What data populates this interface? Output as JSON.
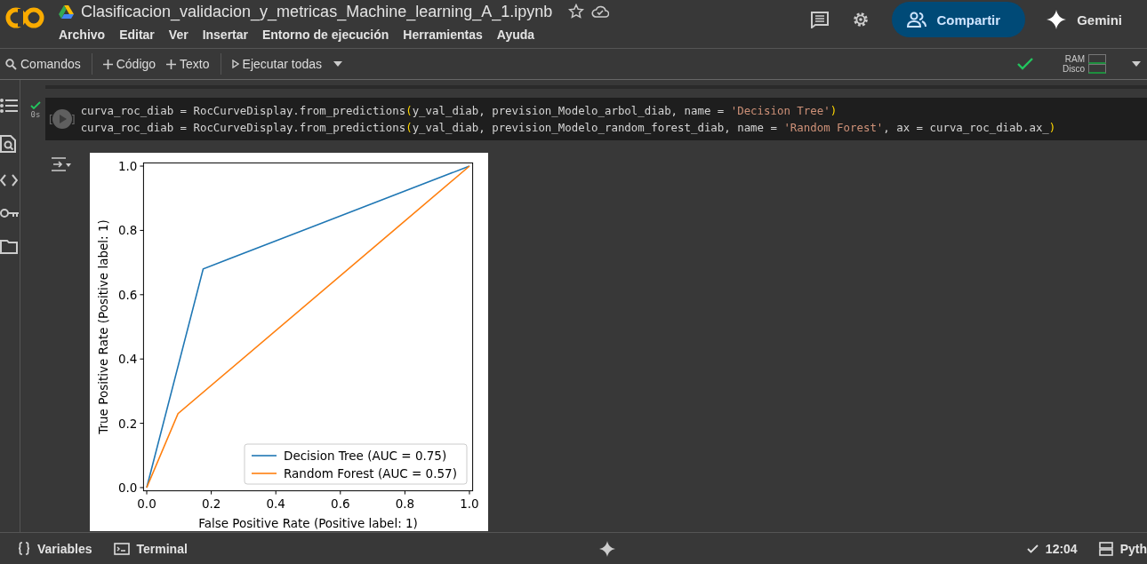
{
  "header": {
    "title": "Clasificacion_validacion_y_metricas_Machine_learning_A_1.ipynb",
    "menu": [
      "Archivo",
      "Editar",
      "Ver",
      "Insertar",
      "Entorno de ejecución",
      "Herramientas",
      "Ayuda"
    ],
    "share_button": "Compartir",
    "gemini_button": "Gemini"
  },
  "toolbar": {
    "commands": "Comandos",
    "add_code": "Código",
    "add_text": "Texto",
    "run_all": "Ejecutar todas",
    "resources": [
      "RAM",
      "Disco"
    ]
  },
  "cell": {
    "run_time": "0s",
    "bracket_open": "[",
    "bracket_close": "]",
    "lines": [
      [
        {
          "kind": "plain",
          "text": "curva_roc_diab = RocCurveDisplay.from_predictions"
        },
        {
          "kind": "paren",
          "text": "("
        },
        {
          "kind": "plain",
          "text": "y_val_diab, prevision_Modelo_arbol_diab, name = "
        },
        {
          "kind": "string",
          "text": "'Decision Tree'"
        },
        {
          "kind": "paren",
          "text": ")"
        }
      ],
      [
        {
          "kind": "plain",
          "text": "curva_roc_diab = RocCurveDisplay.from_predictions"
        },
        {
          "kind": "paren",
          "text": "("
        },
        {
          "kind": "plain",
          "text": "y_val_diab, prevision_Modelo_random_forest_diab, name = "
        },
        {
          "kind": "string",
          "text": "'Random Forest'"
        },
        {
          "kind": "plain",
          "text": ", ax = curva_roc_diab.ax_"
        },
        {
          "kind": "paren",
          "text": ")"
        }
      ]
    ],
    "output": {
      "chart_data": {
        "type": "line",
        "legend": true,
        "xlabel": "False Positive Rate (Positive label: 1)",
        "ylabel": "True Positive Rate (Positive label: 1)",
        "xlim": [
          -0.01,
          1.01
        ],
        "ylim": [
          -0.01,
          1.01
        ],
        "xticks": [
          {
            "value": 0,
            "label": "0.0"
          },
          {
            "value": 0.2,
            "label": "0.2"
          },
          {
            "value": 0.4,
            "label": "0.4"
          },
          {
            "value": 0.6,
            "label": "0.6"
          },
          {
            "value": 0.8,
            "label": "0.8"
          },
          {
            "value": 1,
            "label": "1.0"
          }
        ],
        "yticks": [
          {
            "value": 0,
            "label": "0.0"
          },
          {
            "value": 0.2,
            "label": "0.2"
          },
          {
            "value": 0.4,
            "label": "0.4"
          },
          {
            "value": 0.6,
            "label": "0.6"
          },
          {
            "value": 0.8,
            "label": "0.8"
          },
          {
            "value": 1,
            "label": "1.0"
          }
        ],
        "series": [
          {
            "name": "Decision Tree (AUC = 0.75)",
            "color": "#1f77b4",
            "x": [
              0,
              0.175,
              1
            ],
            "values": [
              0,
              0.68,
              1
            ]
          },
          {
            "name": "Random Forest (AUC = 0.57)",
            "color": "#ff7f0e",
            "x": [
              0,
              0.097,
              1
            ],
            "values": [
              0,
              0.23,
              1
            ]
          }
        ]
      }
    }
  },
  "status_bar": {
    "variables": "Variables",
    "terminal": "Terminal",
    "time": "12:04",
    "runtime": "Pyth"
  }
}
